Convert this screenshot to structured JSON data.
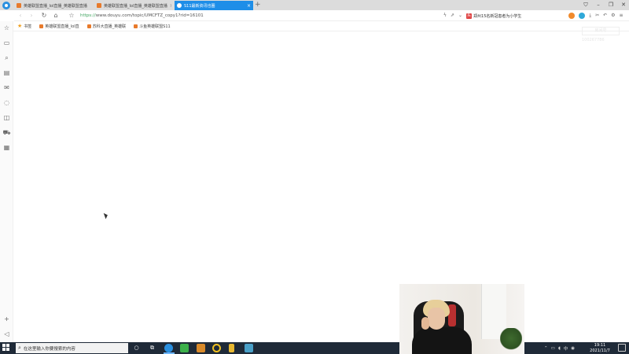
{
  "tabs": [
    {
      "label": "英雄联盟直播_lol直播_英雄联盟直播",
      "active": false
    },
    {
      "label": "英雄联盟直播_lol直播_英雄联盟直播",
      "active": false
    },
    {
      "label": "S11最新资讯也圈",
      "active": true
    }
  ],
  "address_bar": {
    "scheme": "https://",
    "rest": "www.douyu.com/topic/UMCFTZ_copy1?rid=16101",
    "news_text": "郑州15名新冠患者为小学生"
  },
  "bookmarks": {
    "label": "书签",
    "items": [
      "英雄联盟直播_lol直",
      "苏科大直播_英雄联",
      "斗鱼英雄联盟S11"
    ]
  },
  "watermark": {
    "label": "房间号",
    "value": "100267786"
  },
  "taskbar": {
    "search_placeholder": "在这里输入你要搜索的内容",
    "time": "19:11",
    "date": "2021/11/7",
    "ime": "中"
  },
  "colors": {
    "accent": "#1e8ee8",
    "taskbar": "#1f2a38",
    "url_scheme": "#3da35d"
  }
}
